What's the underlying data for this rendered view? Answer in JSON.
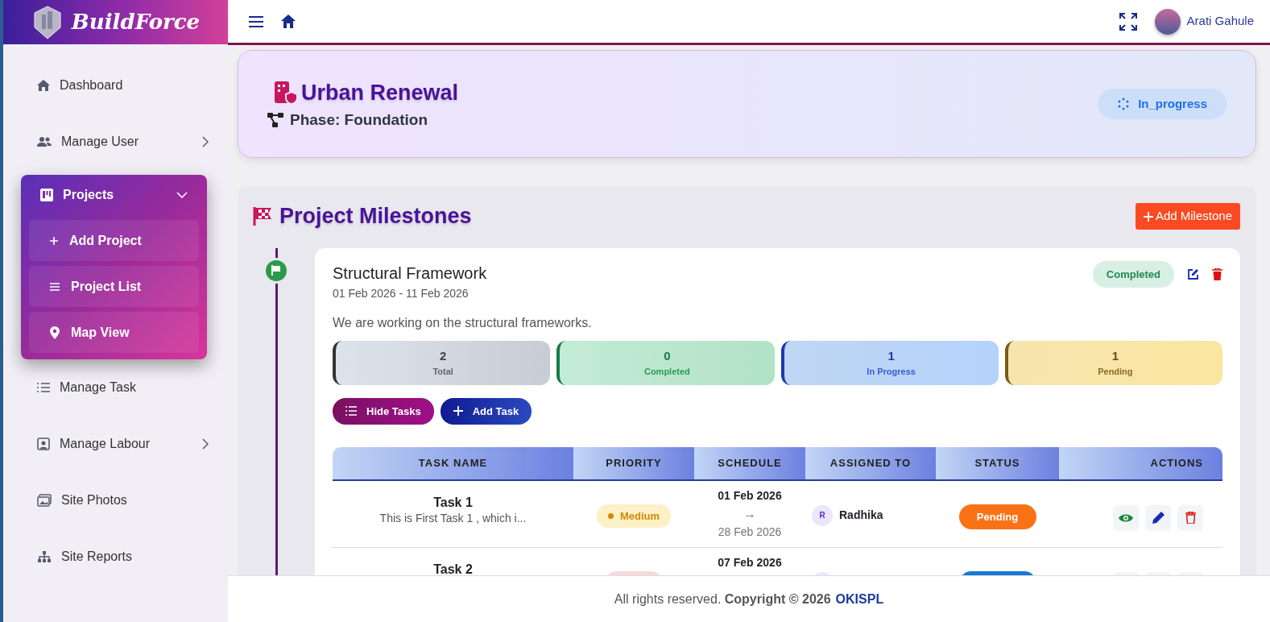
{
  "brand": {
    "name": "BuildForce"
  },
  "sidebar": {
    "items": [
      {
        "label": "Dashboard",
        "selected": false
      },
      {
        "label": "Manage User",
        "selected": false,
        "expanded": false
      },
      {
        "label": "Projects",
        "selected": true,
        "expanded": true,
        "children": [
          {
            "label": "Add Project"
          },
          {
            "label": "Project List"
          },
          {
            "label": "Map View"
          }
        ]
      },
      {
        "label": "Manage Task",
        "selected": false
      },
      {
        "label": "Manage Labour",
        "selected": false,
        "expanded": false
      },
      {
        "label": "Site Photos",
        "selected": false
      },
      {
        "label": "Site Reports",
        "selected": false
      }
    ]
  },
  "topbar": {
    "user_name": "Arati Gahule"
  },
  "project": {
    "title": "Urban Renewal",
    "phase": "Phase: Foundation",
    "status": "In_progress"
  },
  "milestones": {
    "title": "Project Milestones",
    "add_button": "Add Milestone",
    "items": [
      {
        "title": "Structural Framework",
        "dates": "01 Feb 2026 - 11 Feb 2026",
        "status": "Completed",
        "description": "We are working on the structural frameworks.",
        "stats": [
          {
            "kind": "total",
            "value": "2",
            "label": "Total"
          },
          {
            "kind": "completed",
            "value": "0",
            "label": "Completed"
          },
          {
            "kind": "in_progress",
            "value": "1",
            "label": "In Progress"
          },
          {
            "kind": "pending",
            "value": "1",
            "label": "Pending"
          }
        ],
        "buttons": [
          "Hide Tasks",
          "Add Task"
        ],
        "table": {
          "columns": [
            "TASK NAME",
            "PRIORITY",
            "SCHEDULE",
            "ASSIGNED TO",
            "STATUS",
            "ACTIONS"
          ],
          "rows": [
            {
              "name": "Task 1",
              "description": "This is First Task 1 , which i...",
              "priority": {
                "kind": "medium",
                "label": "Medium"
              },
              "start": "01 Feb 2026",
              "arrow": "→",
              "end": "28 Feb 2026",
              "initial": "R",
              "assignee": "Radhika",
              "status": {
                "kind": "pending",
                "label": "Pending"
              }
            },
            {
              "name": "Task 2",
              "start": "07 Feb 2026",
              "priority": {
                "kind": "high"
              },
              "status": {
                "kind": "in_progress"
              }
            }
          ]
        }
      }
    ]
  },
  "footer": {
    "text": "All rights reserved. **Copyright © 2026**",
    "link": "OKISPL"
  }
}
